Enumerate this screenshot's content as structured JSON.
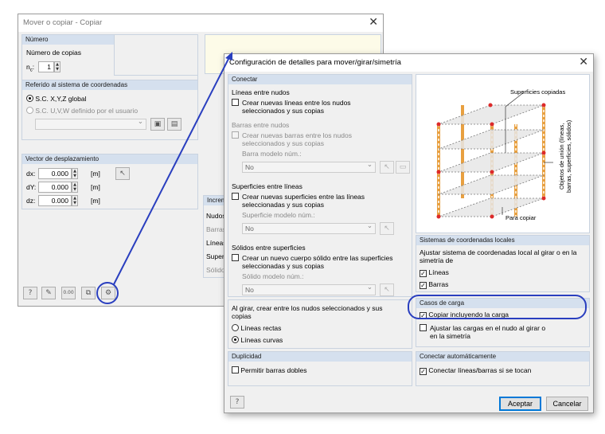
{
  "copy": {
    "title": "Mover o copiar - Copiar",
    "numero": {
      "header": "Número",
      "label": "Número de copias",
      "n_prefix": "n",
      "n_value": "1"
    },
    "ref": {
      "header": "Referido al sistema de coordenadas",
      "opt1": "S.C. X,Y,Z global",
      "opt2": "S.C. U,V,W definido por el usuario"
    },
    "vector": {
      "header": "Vector de desplazamiento",
      "rows": [
        {
          "label": "dx:",
          "value": "0.000",
          "unit": "[m]"
        },
        {
          "label": "dY:",
          "value": "0.000",
          "unit": "[m]"
        },
        {
          "label": "dz:",
          "value": "0.000",
          "unit": "[m]"
        }
      ]
    },
    "incr": {
      "header": "Increm",
      "items": [
        "Nudos",
        "Barras",
        "Líneas",
        "Superfi",
        "Sólido"
      ]
    },
    "footer_icons": [
      "help-icon",
      "edit-icon",
      "units-icon",
      "copy-icon",
      "details-icon"
    ]
  },
  "details": {
    "title": "Configuración de detalles para mover/girar/simetría",
    "conectar": {
      "header": "Conectar",
      "g1": {
        "title": "Líneas entre nudos",
        "cb": "Crear nuevas líneas entre los nudos\nseleccionados y sus copias"
      },
      "g2": {
        "title": "Barras entre nudos",
        "cb": "Crear nuevas barras entre los nudos\nseleccionados y sus copias",
        "model_label": "Barra modelo núm.:",
        "model_value": "No"
      },
      "g3": {
        "title": "Superficies entre líneas",
        "cb": "Crear nuevas superficies entre las líneas\nseleccionadas y sus copias",
        "model_label": "Superficie modelo núm.:",
        "model_value": "No"
      },
      "g4": {
        "title": "Sólidos entre superficies",
        "cb": "Crear un nuevo cuerpo sólido entre las superficies\nseleccionadas y sus copias",
        "model_label": "Sólido modelo núm.:",
        "model_value": "No"
      }
    },
    "girar": {
      "title": "Al girar, crear entre los nudos seleccionados y sus\ncopias",
      "opt1": "Líneas rectas",
      "opt2": "Líneas curvas"
    },
    "duplicidad": {
      "header": "Duplicidad",
      "cb": "Permitir barras dobles"
    },
    "diagram": {
      "label_top": "Superficies copiadas",
      "label_side": "Objetos de unión (líneas,\nbarras, superficies, sólidos)",
      "label_bottom": "Para copiar"
    },
    "sistemas": {
      "header": "Sistemas de coordenadas locales",
      "text": "Ajustar sistema de coordenadas local al girar o en la\nsimetría de",
      "cb1": "Líneas",
      "cb2": "Barras"
    },
    "casos": {
      "header": "Casos de carga",
      "cb1": "Copiar incluyendo la carga",
      "cb2": "Ajustar las cargas en el nudo al girar o\nen la simetría"
    },
    "auto": {
      "header": "Conectar automáticamente",
      "cb": "Conectar líneas/barras si se tocan"
    },
    "buttons": {
      "ok": "Aceptar",
      "cancel": "Cancelar"
    }
  },
  "colors": {
    "highlight": "#2a3fbf",
    "section_header": "#d5e0ee",
    "beam": "#e8a040"
  }
}
